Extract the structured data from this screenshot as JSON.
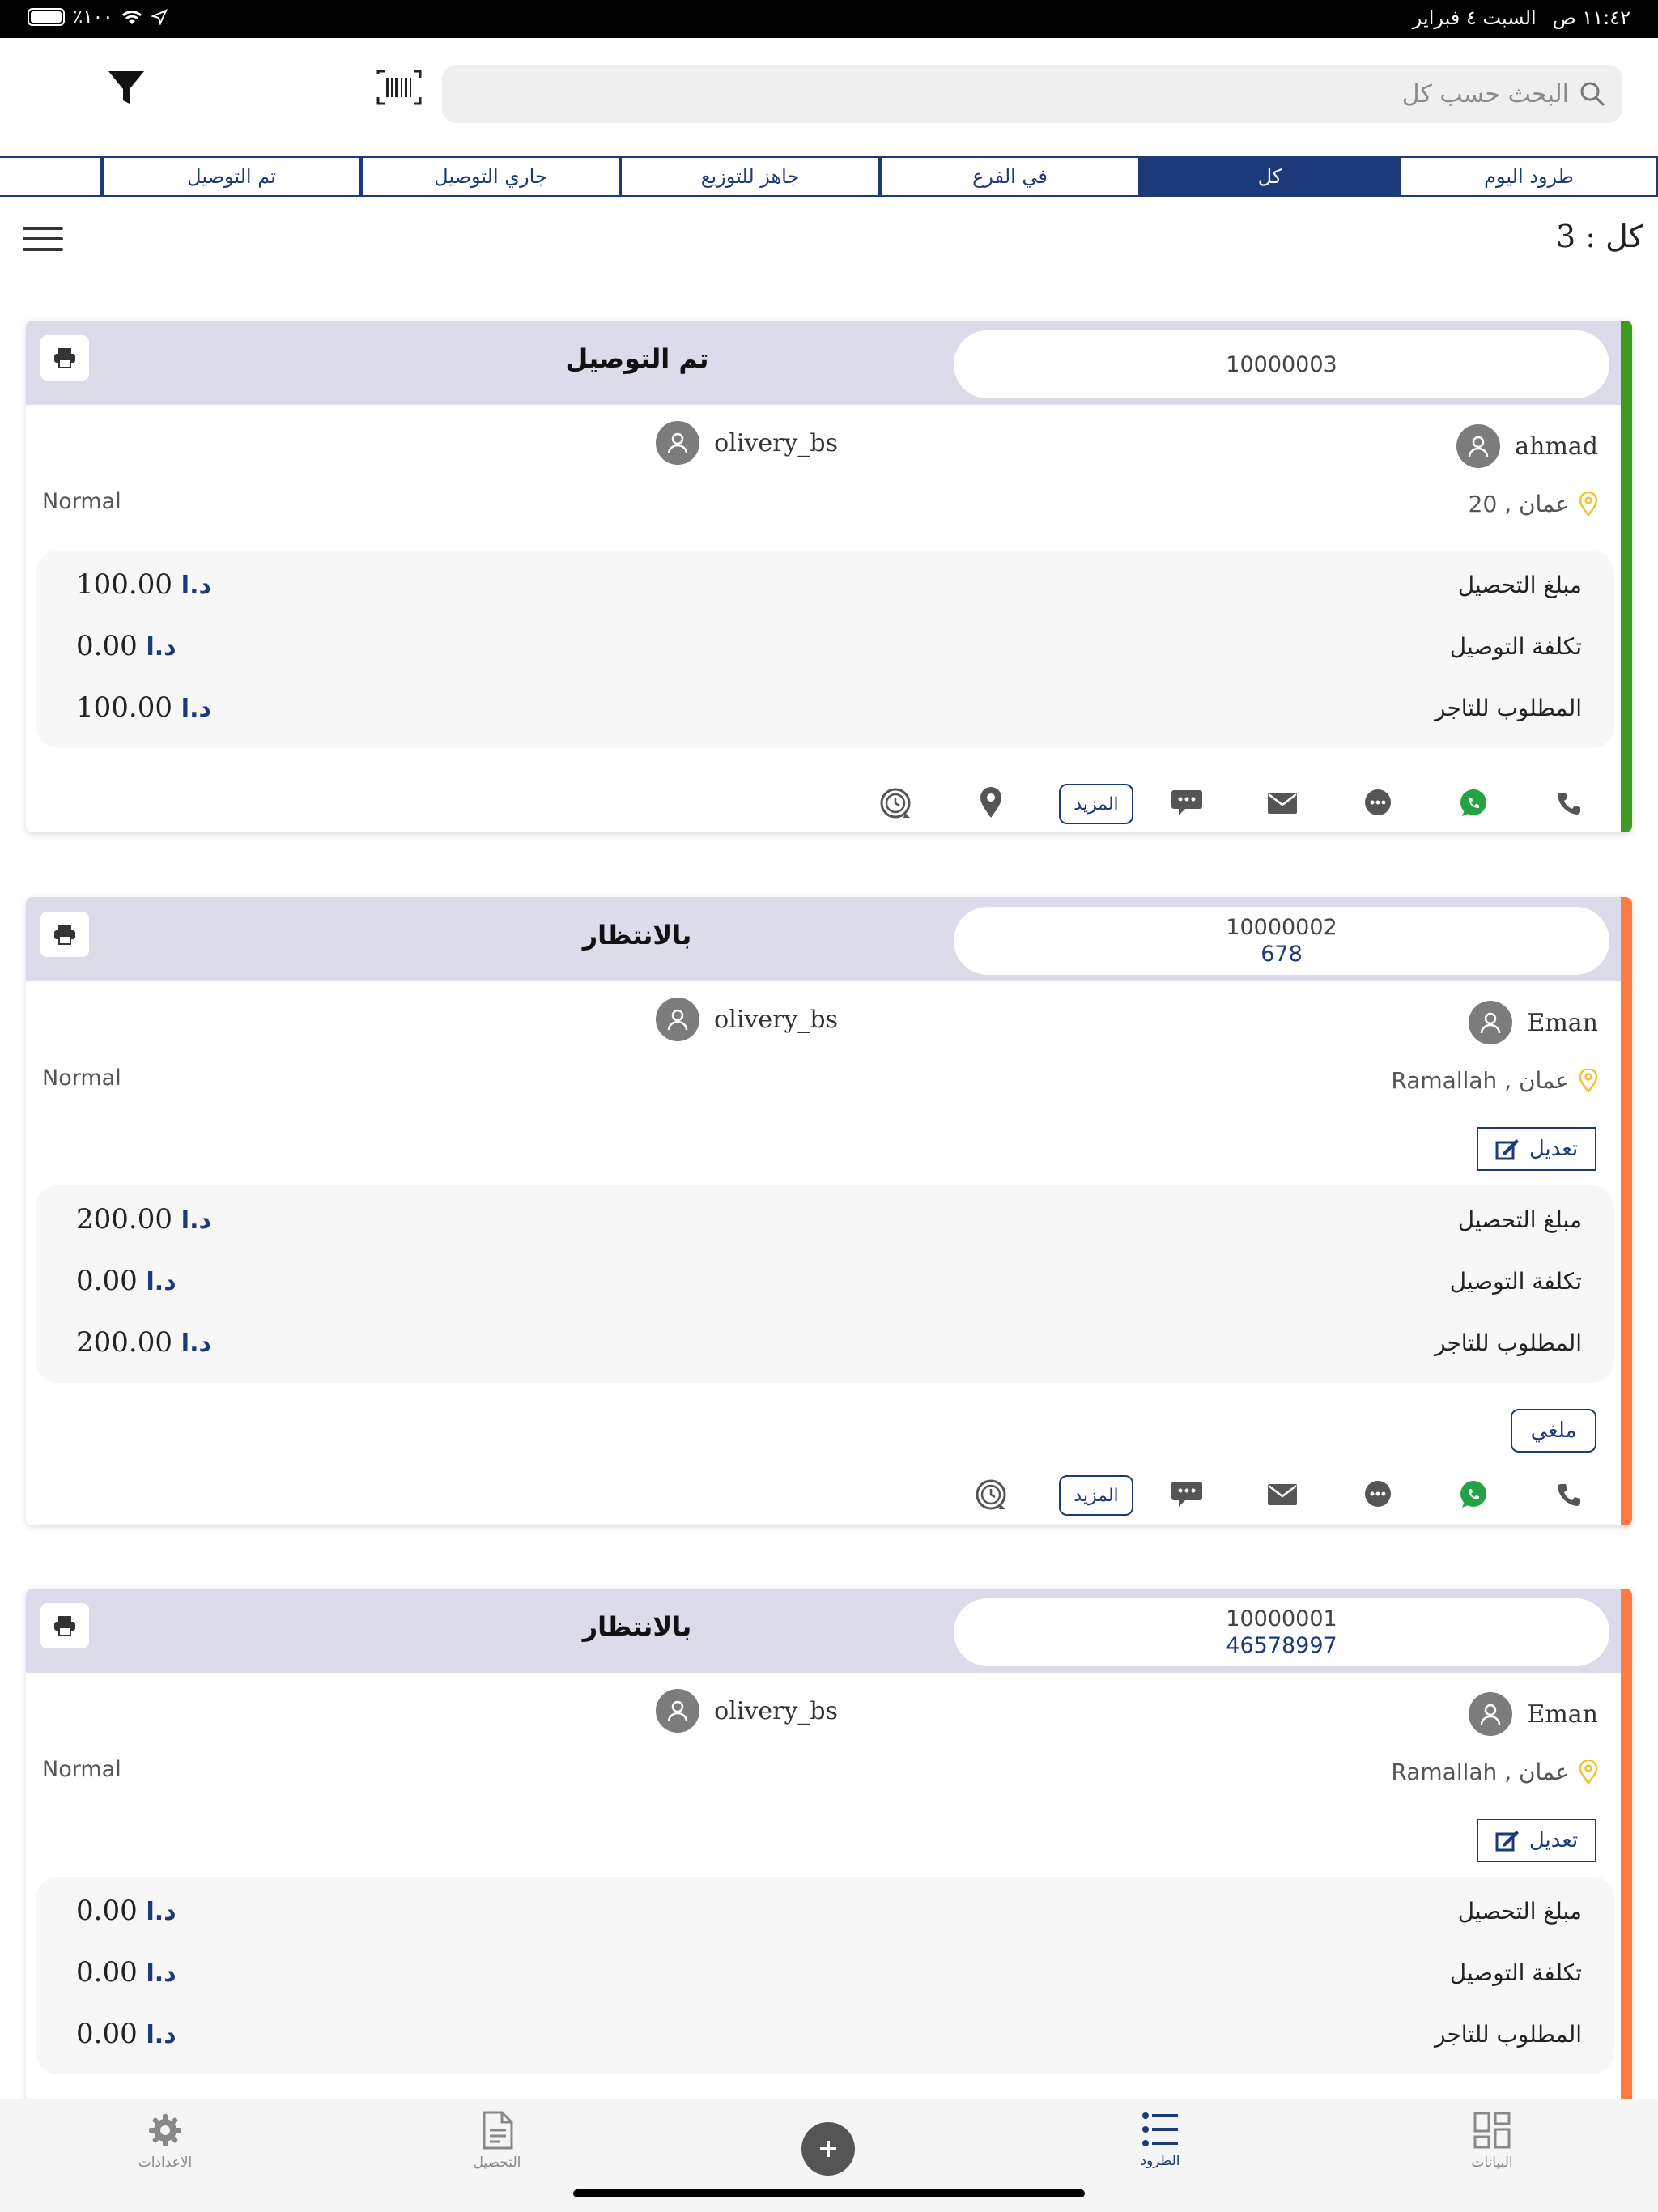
{
  "status_bar": {
    "battery": "٪١٠٠",
    "time": "١١:٤٢ ص",
    "date": "السبت ٤ فبراير"
  },
  "search": {
    "placeholder": "البحث حسب كل"
  },
  "tabs": [
    {
      "label": "طرود اليوم",
      "active": false
    },
    {
      "label": "كل",
      "active": true
    },
    {
      "label": "في الفرع",
      "active": false
    },
    {
      "label": "جاهز للتوزيع",
      "active": false
    },
    {
      "label": "جاري التوصيل",
      "active": false
    },
    {
      "label": "تم التوصيل",
      "active": false
    }
  ],
  "count_label": "كل : 3",
  "labels": {
    "collection_amount": "مبلغ التحصيل",
    "delivery_cost": "تكلفة التوصيل",
    "merchant_due": "المطلوب للتاجر",
    "currency": "د.ا",
    "edit": "تعديل",
    "cancelled": "ملغي",
    "more": "المزيد"
  },
  "cards": [
    {
      "reference": "10000003",
      "sub_reference": "",
      "status": "تم التوصيل",
      "stripe_color": "#3f9a1f",
      "customer": "ahmad",
      "sender": "olivery_bs",
      "service_type": "Normal",
      "location": "عمان , 20",
      "collection_amount": "100.00",
      "delivery_cost": "0.00",
      "merchant_due": "100.00"
    },
    {
      "reference": "10000002",
      "sub_reference": "678",
      "status": "بالانتظار",
      "stripe_color": "#ff7a45",
      "customer": "Eman",
      "sender": "olivery_bs",
      "service_type": "Normal",
      "location": "عمان , Ramallah",
      "collection_amount": "200.00",
      "delivery_cost": "0.00",
      "merchant_due": "200.00"
    },
    {
      "reference": "10000001",
      "sub_reference": "46578997",
      "status": "بالانتظار",
      "stripe_color": "#ff7a45",
      "customer": "Eman",
      "sender": "olivery_bs",
      "service_type": "Normal",
      "location": "عمان , Ramallah",
      "collection_amount": "0.00",
      "delivery_cost": "0.00",
      "merchant_due": "0.00"
    }
  ],
  "bottom_nav": [
    {
      "label": "الاعدادات",
      "icon": "gear-icon"
    },
    {
      "label": "التحصيل",
      "icon": "document-icon"
    },
    {
      "label": "الطرود",
      "icon": "list-icon",
      "active": true
    },
    {
      "label": "البيانات",
      "icon": "dashboard-icon"
    }
  ],
  "colors": {
    "primary": "#1d3a78",
    "header_bg": "#dcdbe9",
    "delivered": "#3f9a1f",
    "waiting": "#ff7a45",
    "whatsapp": "#25a244",
    "location_pin": "#f2c230"
  }
}
